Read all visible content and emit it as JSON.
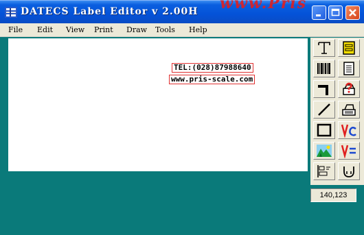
{
  "window": {
    "title": "DATECS Label Editor v 2.00H",
    "watermark": "www.Pris",
    "controls": [
      "minimize",
      "maximize",
      "close"
    ]
  },
  "menu": [
    "File",
    "Edit",
    "View",
    "Print",
    "Draw",
    "Tools",
    "Help"
  ],
  "label": {
    "fields": [
      {
        "text": "TEL:(028)87988640"
      },
      {
        "text": "www.pris-scale.com"
      }
    ]
  },
  "toolbox": {
    "tools": [
      {
        "icon": "text-tool-icon"
      },
      {
        "icon": "field-frame-icon"
      },
      {
        "icon": "barcode-icon"
      },
      {
        "icon": "document-list-icon"
      },
      {
        "icon": "hammer-icon"
      },
      {
        "icon": "printer-help-icon"
      },
      {
        "icon": "line-tool-icon"
      },
      {
        "icon": "printer-icon"
      },
      {
        "icon": "rectangle-tool-icon"
      },
      {
        "icon": "variable-counter-icon"
      },
      {
        "icon": "picture-tool-icon"
      },
      {
        "icon": "variable-equal-icon"
      },
      {
        "icon": "align-icon"
      },
      {
        "icon": "connect-icon"
      }
    ],
    "cursor_position": "140,123"
  },
  "colors": {
    "desktop": "#0a7a7a",
    "titlebar": "#0452d8",
    "label_border": "#e03030",
    "toolbox": "#ece9d8"
  }
}
